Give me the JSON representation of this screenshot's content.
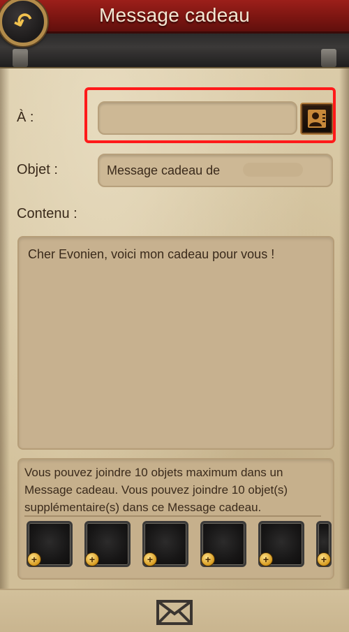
{
  "header": {
    "title": "Message cadeau",
    "back_icon": "back-arrow-icon"
  },
  "form": {
    "to_label": "À :",
    "to_value": "",
    "contacts_icon": "contacts-icon",
    "subject_label": "Objet :",
    "subject_value": "Message cadeau de",
    "content_label": "Contenu :",
    "content_value": "Cher Evonien, voici mon cadeau pour vous !"
  },
  "attachments": {
    "info": "Vous pouvez joindre 10 objets maximum dans un Message cadeau. Vous pouvez joindre 10 objet(s) supplémentaire(s) dans ce Message cadeau.",
    "max_items": 10,
    "remaining_items": 10,
    "slot_icon": "add-item-icon"
  },
  "footer": {
    "send_icon": "envelope-icon"
  },
  "colors": {
    "header_red": "#7a1511",
    "parchment": "#d6c5a0",
    "highlight_red": "#ff1a1a",
    "text_brown": "#3a2a1b"
  }
}
